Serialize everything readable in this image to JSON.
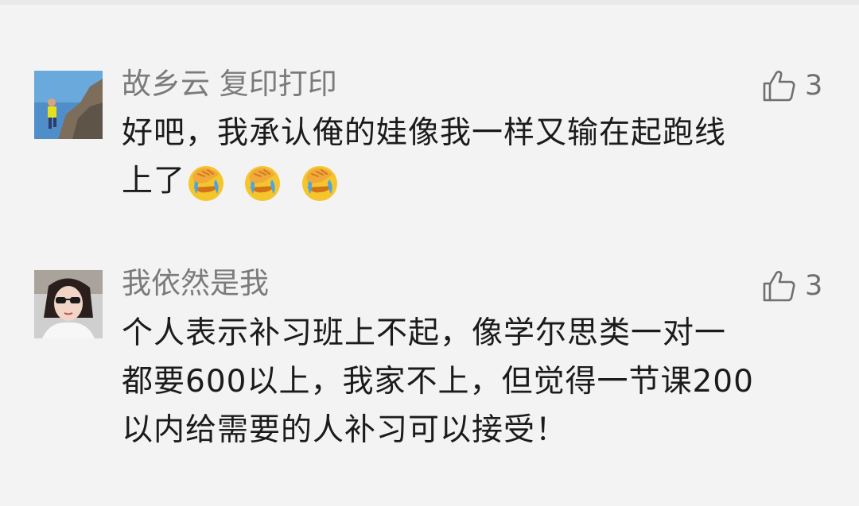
{
  "comments": [
    {
      "user": "故乡云 复印打印",
      "likes": "3",
      "lines": [
        "好吧，我承认俺的娃像我一样又输在起跑线",
        "上了"
      ],
      "emoji": [
        "facepalm-cry-emoji",
        "facepalm-cry-emoji",
        "facepalm-cry-emoji"
      ]
    },
    {
      "user": "我依然是我",
      "likes": "3",
      "lines": [
        "个人表示补习班上不起，像学尔思类一对一",
        "都要600以上，我家不上，但觉得一节课200",
        "以内给需要的人补习可以接受！"
      ]
    }
  ],
  "icons": {
    "like": "thumbs-up-outline-icon"
  },
  "colors": {
    "background": "#f3f3f3",
    "nickname": "#7b7b7b",
    "body_text": "#1b1b1b",
    "like": "#6f6f6f"
  }
}
